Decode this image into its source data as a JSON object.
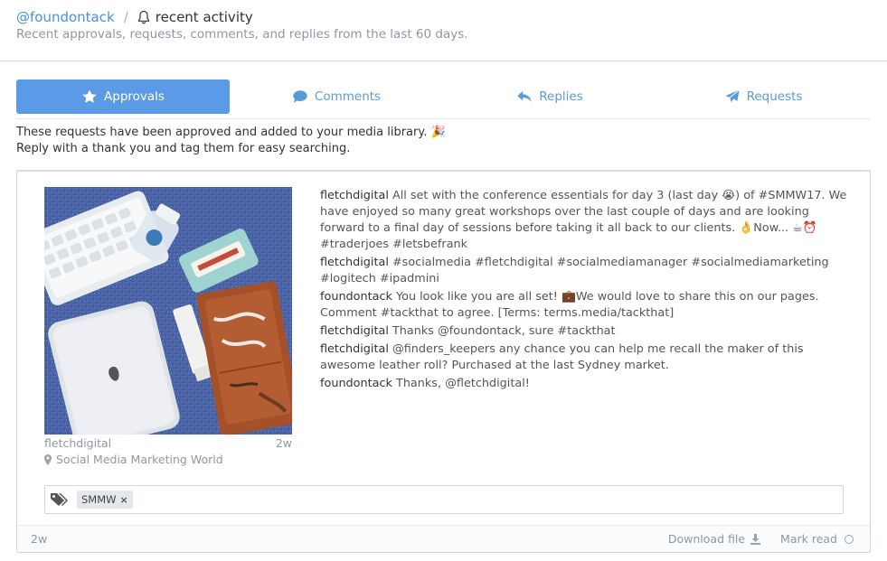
{
  "header": {
    "handle": "@foundontack",
    "separator": "/",
    "title": "recent activity",
    "subtitle": "Recent approvals, requests, comments, and replies from the last 60 days."
  },
  "tabs": [
    {
      "label": "Approvals",
      "icon": "star-icon",
      "active": true
    },
    {
      "label": "Comments",
      "icon": "speech-bubble-icon",
      "active": false
    },
    {
      "label": "Replies",
      "icon": "reply-arrow-icon",
      "active": false
    },
    {
      "label": "Requests",
      "icon": "paper-plane-icon",
      "active": false
    }
  ],
  "note": {
    "line1": "These requests have been approved and added to your media library. 🎉",
    "line2": "Reply with a thank you and tag them for easy searching."
  },
  "card": {
    "author": "fletchdigital",
    "age": "2w",
    "location": "Social Media Marketing World",
    "comments": [
      {
        "user": "fletchdigital",
        "text": " All set with the conference essentials for day 3 (last day 😭) of #SMMW17. We have enjoyed so many great workshops over the last couple of days and are looking forward to a final day of sessions before taking it all back to our clients. 👌Now... ☕⏰ #traderjoes #letsbefrank"
      },
      {
        "user": "fletchdigital",
        "text": " #socialmedia #fletchdigital #socialmediamanager #socialmediamarketing #logitech #ipadmini"
      },
      {
        "user": "foundontack",
        "text": " You look like you are all set! 💼We would love to share this on our pages. Comment #tackthat to agree. [Terms: terms.media/tackthat]"
      },
      {
        "user": "fletchdigital",
        "text": " Thanks @foundontack, sure #tackthat"
      },
      {
        "user": "fletchdigital",
        "text": " @finders_keepers any chance you can help me recall the maker of this awesome leather roll? Purchased at the last Sydney market."
      },
      {
        "user": "foundontack",
        "text": " Thanks, @fletchdigital!"
      }
    ],
    "tags": [
      "SMMW"
    ],
    "tag_remove": "×",
    "footer_age": "2w",
    "download_label": "Download file",
    "mark_read_label": "Mark read"
  },
  "colors": {
    "accent": "#5a9ae6",
    "link": "#4a90e2",
    "muted": "#8e98a2"
  }
}
